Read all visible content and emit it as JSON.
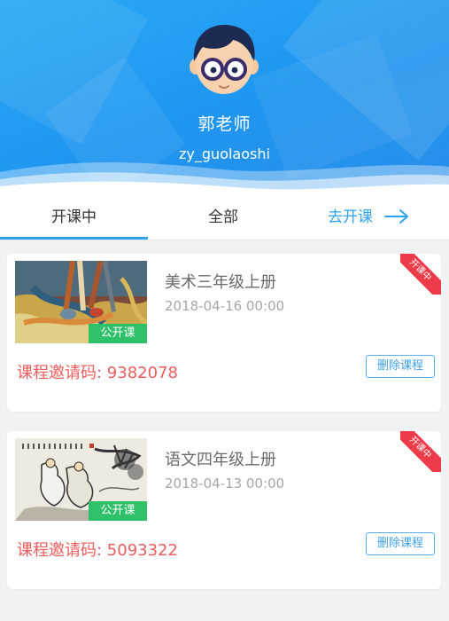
{
  "profile": {
    "name": "郭老师",
    "username": "zy_guolaoshi"
  },
  "tabs": {
    "ongoing": "开课中",
    "all": "全部",
    "start": "去开课"
  },
  "courses": [
    {
      "title": "美术三年级上册",
      "date": "2018-04-16 00:00",
      "badge": "公开课",
      "status": "开课中",
      "invite_label": "课程邀请码: 9382078",
      "delete_label": "删除课程"
    },
    {
      "title": "语文四年级上册",
      "date": "2018-04-13 00:00",
      "badge": "公开课",
      "status": "开课中",
      "invite_label": "课程邀请码: 5093322",
      "delete_label": "删除课程"
    }
  ],
  "colors": {
    "header_blue": "#1f95ef",
    "accent": "#2ea3ec",
    "invite_red": "#ee5c5c",
    "badge_green": "#2fc06a",
    "ribbon_red": "#ee3b4a"
  },
  "icons": [
    "teacher-avatar-icon",
    "arrow-right-icon"
  ]
}
